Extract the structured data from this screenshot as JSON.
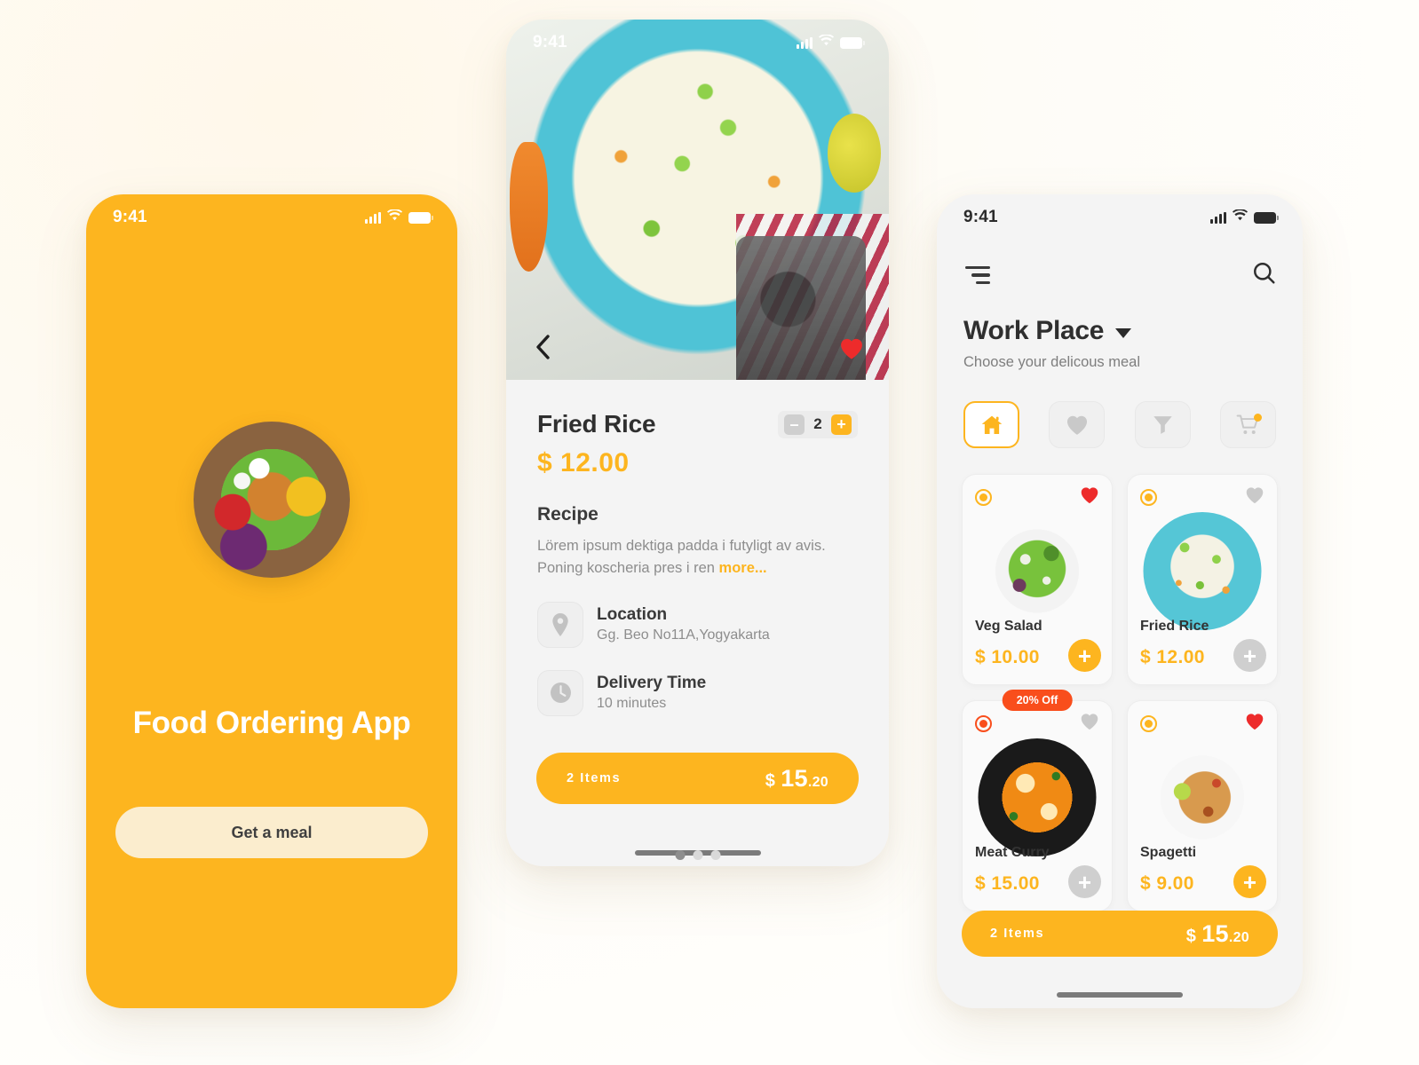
{
  "theme": {
    "primary": "#FDB51F",
    "accent_red": "#F94E1C",
    "heart_red": "#ED2B2B",
    "screen_bg": "#f4f4f4",
    "page_bg": "#fefcf7"
  },
  "phone_splash": {
    "status": {
      "time": "9:41"
    },
    "title": "Food Ordering App",
    "cta_label": "Get a meal",
    "hero_image_alt": "salad-bowl"
  },
  "phone_detail": {
    "status": {
      "time": "9:41"
    },
    "hero_image_alt": "fried-rice-bowl",
    "carousel": {
      "total": 3,
      "active": 1
    },
    "favorited": true,
    "product": {
      "name": "Fried Rice",
      "price": "$ 12.00",
      "quantity": "2",
      "minus_label": "–",
      "plus_label": "+"
    },
    "recipe": {
      "heading": "Recipe",
      "text": "Lörem ipsum dektiga padda i futyligt av avis. Poning koscheria pres i ren ",
      "more_label": "more..."
    },
    "info": [
      {
        "icon": "location-pin-icon",
        "title": "Location",
        "value": "Gg. Beo No11A,Yogyakarta"
      },
      {
        "icon": "clock-icon",
        "title": "Delivery Time",
        "value": "10 minutes"
      }
    ],
    "cart": {
      "items_label": "2 Items",
      "currency": "$",
      "amount": "15",
      "cents": ".20"
    }
  },
  "phone_home": {
    "status": {
      "time": "9:41"
    },
    "menu_icon": "hamburger-menu-icon",
    "search_icon": "search-icon",
    "place": "Work Place",
    "subtitle": "Choose your delicous meal",
    "tabs": [
      {
        "id": "home",
        "icon": "home-icon",
        "active": true,
        "badge": false
      },
      {
        "id": "favorites",
        "icon": "heart-icon",
        "active": false,
        "badge": false
      },
      {
        "id": "filter",
        "icon": "funnel-icon",
        "active": false,
        "badge": false
      },
      {
        "id": "cart",
        "icon": "cart-icon",
        "active": false,
        "badge": true
      }
    ],
    "products": [
      {
        "name": "Veg Salad",
        "price": "$ 10.00",
        "image": "plate-salad",
        "selected": true,
        "select_color": "#FDB51F",
        "favorited": true,
        "add_enabled": true,
        "badge": null
      },
      {
        "name": "Fried Rice",
        "price": "$ 12.00",
        "image": "bowl-rice",
        "selected": true,
        "select_color": "#FDB51F",
        "favorited": false,
        "add_enabled": false,
        "badge": null
      },
      {
        "name": "Meat Curry",
        "price": "$ 15.00",
        "image": "bowl-curry",
        "selected": true,
        "select_color": "#F94E1C",
        "favorited": false,
        "add_enabled": false,
        "badge": "20% Off"
      },
      {
        "name": "Spagetti",
        "price": "$ 9.00",
        "image": "plate-spag",
        "selected": true,
        "select_color": "#FDB51F",
        "favorited": true,
        "add_enabled": true,
        "badge": null
      }
    ],
    "add_label": "+",
    "cart": {
      "items_label": "2 Items",
      "currency": "$",
      "amount": "15",
      "cents": ".20"
    }
  }
}
